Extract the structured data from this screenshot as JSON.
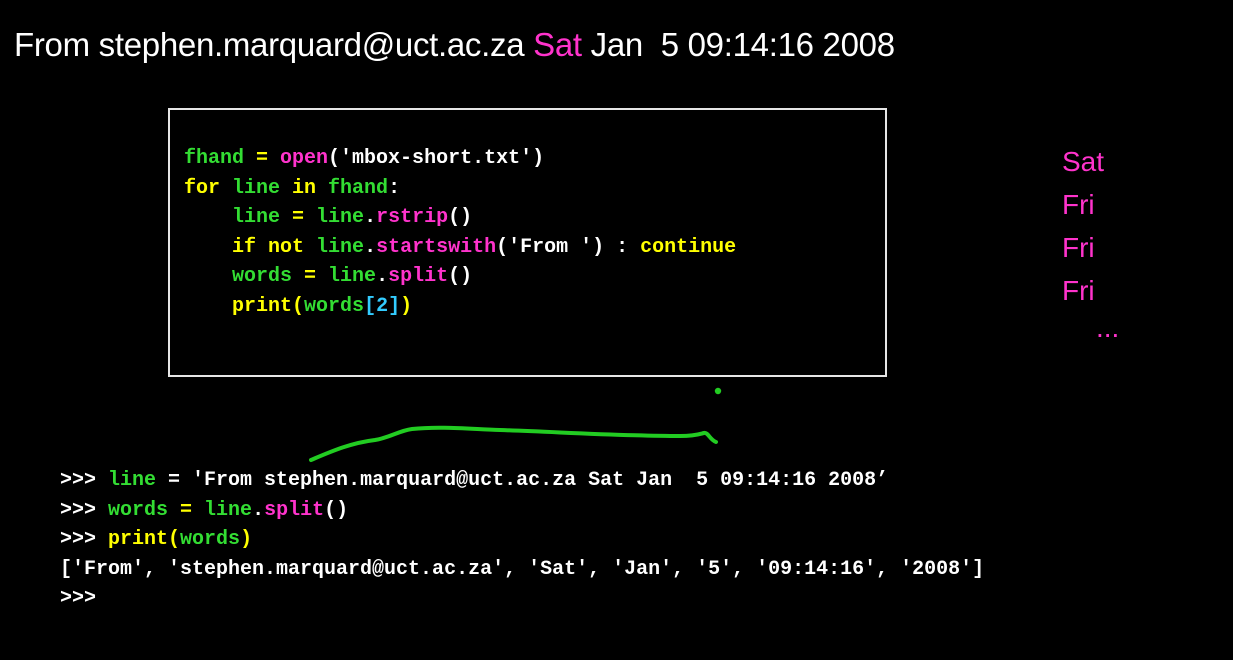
{
  "heading": {
    "prefix": "From stephen.marquard@uct.ac.za ",
    "highlight": "Sat",
    "suffix": " Jan  5 09:14:16 2008"
  },
  "code": {
    "l1": {
      "var": "fhand",
      "eq": " = ",
      "fn": "open",
      "arg": "('mbox-short.txt')"
    },
    "l2": {
      "kw_for": "for",
      "var": " line ",
      "kw_in": "in",
      "iter": " fhand",
      "colon": ":"
    },
    "l3": {
      "indent": "    ",
      "var": "line",
      "eq": " = ",
      "obj": "line",
      "dot": ".",
      "fn": "rstrip",
      "parens": "()"
    },
    "l4": {
      "indent": "    ",
      "kw_if": "if not",
      "sp": " ",
      "obj": "line",
      "dot": ".",
      "fn": "startswith",
      "arg": "('From ')",
      "colon": " : ",
      "kw_cont": "continue"
    },
    "l5": {
      "indent": "    ",
      "var": "words",
      "eq": " = ",
      "obj": "line",
      "dot": ".",
      "fn": "split",
      "parens": "()"
    },
    "l6": {
      "indent": "    ",
      "fn": "print",
      "open": "(",
      "var": "words",
      "idx": "[2]",
      "close": ")"
    }
  },
  "day_list": [
    "Sat",
    "Fri",
    "Fri",
    "Fri",
    "..."
  ],
  "console": {
    "l1": {
      "prompt": ">>> ",
      "var": "line",
      "rest": " = 'From stephen.marquard@uct.ac.za Sat Jan  5 09:14:16 2008’"
    },
    "l2": {
      "prompt": ">>> ",
      "var": "words",
      "eq": " = ",
      "obj": "line",
      "dot": ".",
      "fn": "split",
      "parens": "()"
    },
    "l3": {
      "prompt": ">>> ",
      "fn": "print",
      "open": "(",
      "var": "words",
      "close": ")"
    },
    "l4": {
      "output": "['From', 'stephen.marquard@uct.ac.za', 'Sat', 'Jan', '5', '09:14:16', '2008']"
    },
    "l5": {
      "prompt": ">>>"
    }
  },
  "colors": {
    "green": "#33dd33",
    "yellow": "#ffff00",
    "magenta": "#ff33cc",
    "cyan": "#33ccff",
    "white": "#ffffff"
  }
}
